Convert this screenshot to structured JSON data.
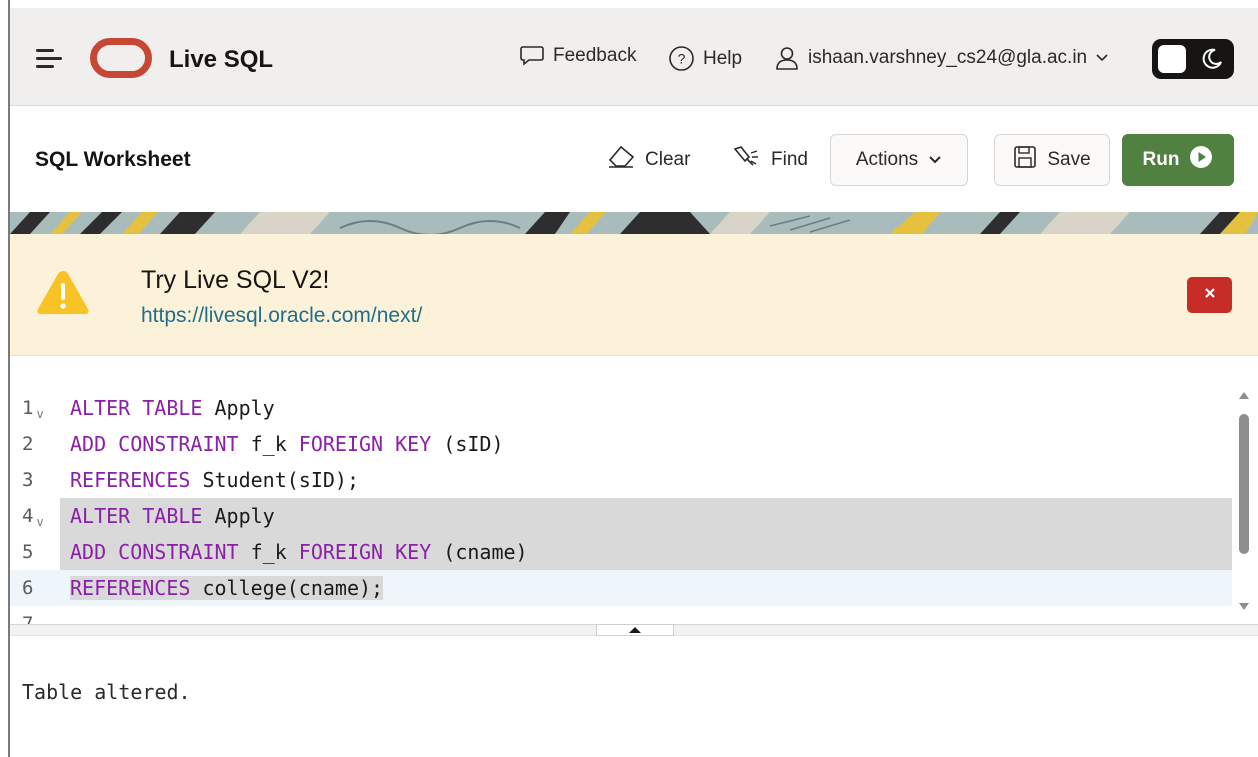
{
  "header": {
    "app_title": "Live SQL",
    "feedback_label": "Feedback",
    "help_label": "Help",
    "user_email": "ishaan.varshney_cs24@gla.ac.in"
  },
  "toolbar": {
    "title": "SQL Worksheet",
    "clear_label": "Clear",
    "find_label": "Find",
    "actions_label": "Actions",
    "save_label": "Save",
    "run_label": "Run"
  },
  "alert": {
    "title": "Try Live SQL V2!",
    "link": "https://livesql.oracle.com/next/",
    "close_label": "×"
  },
  "editor": {
    "lines": [
      {
        "number": "1",
        "tokens": [
          {
            "t": "kw",
            "v": "ALTER TABLE"
          },
          {
            "t": "tx",
            "v": " Apply"
          }
        ]
      },
      {
        "number": "2",
        "tokens": [
          {
            "t": "kw",
            "v": "ADD CONSTRAINT"
          },
          {
            "t": "tx",
            "v": " f_k "
          },
          {
            "t": "kw",
            "v": "FOREIGN KEY"
          },
          {
            "t": "tx",
            "v": " (sID)"
          }
        ]
      },
      {
        "number": "3",
        "tokens": [
          {
            "t": "kw",
            "v": "REFERENCES"
          },
          {
            "t": "tx",
            "v": " Student(sID);"
          }
        ]
      },
      {
        "number": "4",
        "tokens": [
          {
            "t": "kw",
            "v": "ALTER TABLE"
          },
          {
            "t": "tx",
            "v": " Apply"
          }
        ]
      },
      {
        "number": "5",
        "tokens": [
          {
            "t": "kw",
            "v": "ADD CONSTRAINT"
          },
          {
            "t": "tx",
            "v": " f_k "
          },
          {
            "t": "kw",
            "v": "FOREIGN KEY"
          },
          {
            "t": "tx",
            "v": " (cname)"
          }
        ]
      },
      {
        "number": "6",
        "tokens": [
          {
            "t": "kw",
            "v": "REFERENCES"
          },
          {
            "t": "tx",
            "v": " college(cname);"
          }
        ]
      }
    ]
  },
  "output": {
    "message": "Table altered."
  },
  "colors": {
    "brand_red": "#c74634",
    "run_green": "#508140",
    "keyword_purple": "#8a1fa8",
    "alert_bg": "#fcf2d9",
    "close_red": "#c62d28",
    "link_teal": "#1f6f8b"
  }
}
